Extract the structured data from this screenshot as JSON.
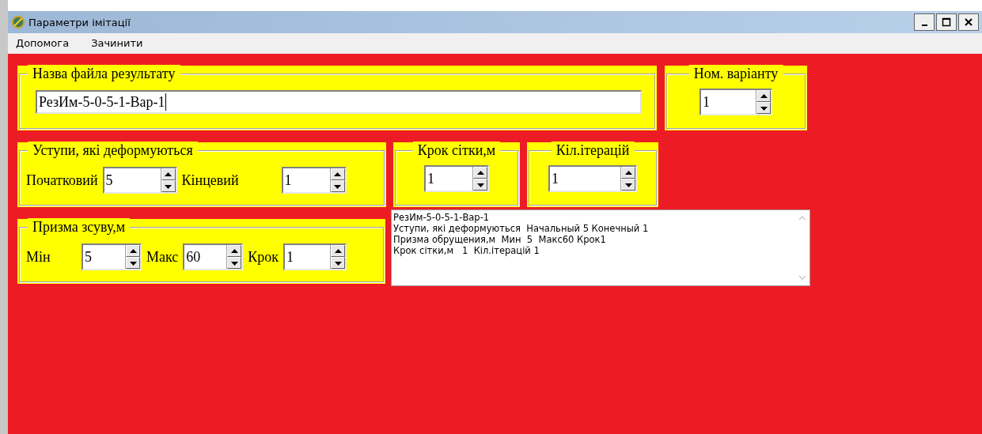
{
  "window": {
    "title": "Параметри імітації"
  },
  "menu": [
    "Допомога",
    "Зачинити"
  ],
  "rows": [
    [
      {
        "kind": "group",
        "legend": "Назва файла результату",
        "fields": [
          {
            "kind": "text",
            "value": "РезИм-5-0-5-1-Вар-1"
          }
        ]
      },
      {
        "kind": "group",
        "legend": "Ном. варіанту",
        "fields": [
          {
            "kind": "spin",
            "value": "1"
          }
        ]
      }
    ],
    [
      {
        "kind": "group",
        "legend": "Уступи, які деформуються",
        "fields": [
          {
            "kind": "spin",
            "label": "Початковий",
            "value": "5"
          },
          {
            "kind": "spin",
            "label": "Кінцевий",
            "value": "1"
          }
        ]
      },
      {
        "kind": "group",
        "legend": "Крок сітки,м",
        "fields": [
          {
            "kind": "spin",
            "value": "1"
          }
        ]
      },
      {
        "kind": "group",
        "legend": "Кіл.ітерацій",
        "fields": [
          {
            "kind": "spin",
            "value": "1"
          }
        ]
      }
    ],
    [
      {
        "kind": "group",
        "legend": "Призма зсуву,м",
        "fields": [
          {
            "kind": "spin",
            "label": "Мін",
            "value": "5"
          },
          {
            "kind": "spin",
            "label": "Макс",
            "value": "60"
          },
          {
            "kind": "spin",
            "label": "Крок",
            "value": "1"
          }
        ]
      },
      {
        "kind": "log",
        "lines": [
          "РезИм-5-0-5-1-Вар-1",
          "Уступи, які деформуються  Начальный 5 Конечный 1",
          "Призма обрущения,м  Мин  5  Макс60 Крок1",
          "Крок сітки,м   1  Кіл.ітерацій 1"
        ]
      }
    ]
  ]
}
